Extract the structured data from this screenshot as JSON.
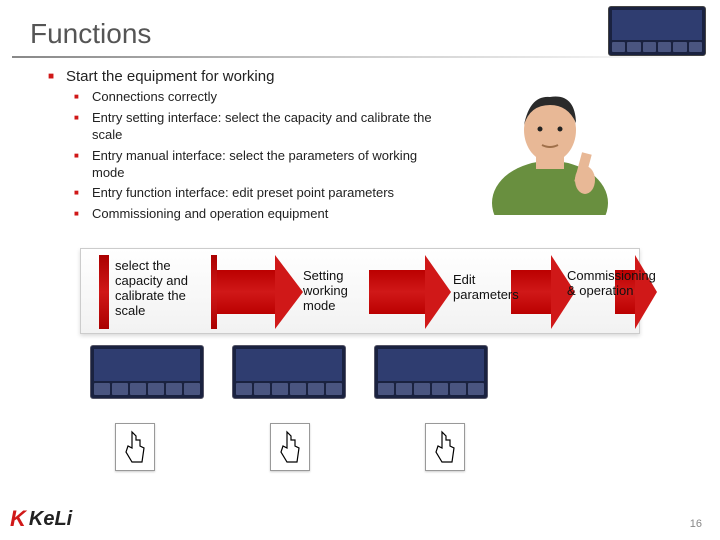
{
  "title": "Functions",
  "bullets": {
    "l1": "Start the equipment for working",
    "l2": [
      "Connections correctly",
      "Entry setting interface: select the capacity and calibrate the scale",
      "Entry manual interface: select the parameters of working mode",
      "Entry function interface: edit preset point parameters",
      "Commissioning and operation equipment"
    ]
  },
  "flow": {
    "steps": [
      "select the capacity and calibrate the scale",
      "Setting working mode",
      "Edit parameters",
      "Commissioning & operation"
    ]
  },
  "logo": {
    "k": "K",
    "rest": "KeLi"
  },
  "page_number": "16"
}
